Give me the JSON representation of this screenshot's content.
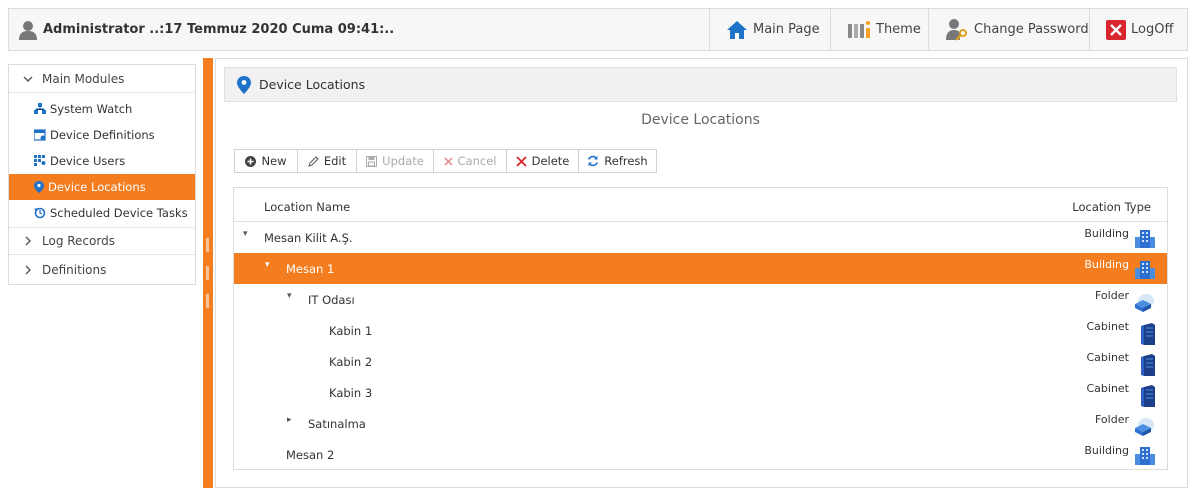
{
  "header": {
    "title": "Administrator  ..:17 Temmuz 2020 Cuma 09:41:..",
    "buttons": {
      "main_page": "Main Page",
      "theme": "Theme",
      "change_password": "Change Password",
      "logoff": "LogOff"
    }
  },
  "sidebar": {
    "groups": [
      "Main Modules",
      "Log Records",
      "Definitions"
    ],
    "items": [
      "System Watch",
      "Device Definitions",
      "Device Users",
      "Device Locations",
      "Scheduled Device Tasks"
    ]
  },
  "panel": {
    "header_title": "Device Locations",
    "subtitle": "Device Locations"
  },
  "toolbar": {
    "new": "New",
    "edit": "Edit",
    "update": "Update",
    "cancel": "Cancel",
    "delete": "Delete",
    "refresh": "Refresh"
  },
  "grid": {
    "columns": [
      "Location Name",
      "Location Type"
    ],
    "rows": [
      {
        "name": "Mesan Kilit A.Ş.",
        "type": "Building",
        "icon": "building-icon"
      },
      {
        "name": "Mesan 1",
        "type": "Building",
        "icon": "building-icon"
      },
      {
        "name": "IT Odası",
        "type": "Folder",
        "icon": "folder-icon"
      },
      {
        "name": "Kabin 1",
        "type": "Cabinet",
        "icon": "cabinet-icon"
      },
      {
        "name": "Kabin 2",
        "type": "Cabinet",
        "icon": "cabinet-icon"
      },
      {
        "name": "Kabin 3",
        "type": "Cabinet",
        "icon": "cabinet-icon"
      },
      {
        "name": "Satınalma",
        "type": "Folder",
        "icon": "folder-icon"
      },
      {
        "name": "Mesan 2",
        "type": "Building",
        "icon": "building-icon"
      }
    ]
  },
  "colors": {
    "accent": "#f47d20",
    "link_blue": "#1e73c9",
    "logoff_red": "#d9262c"
  }
}
